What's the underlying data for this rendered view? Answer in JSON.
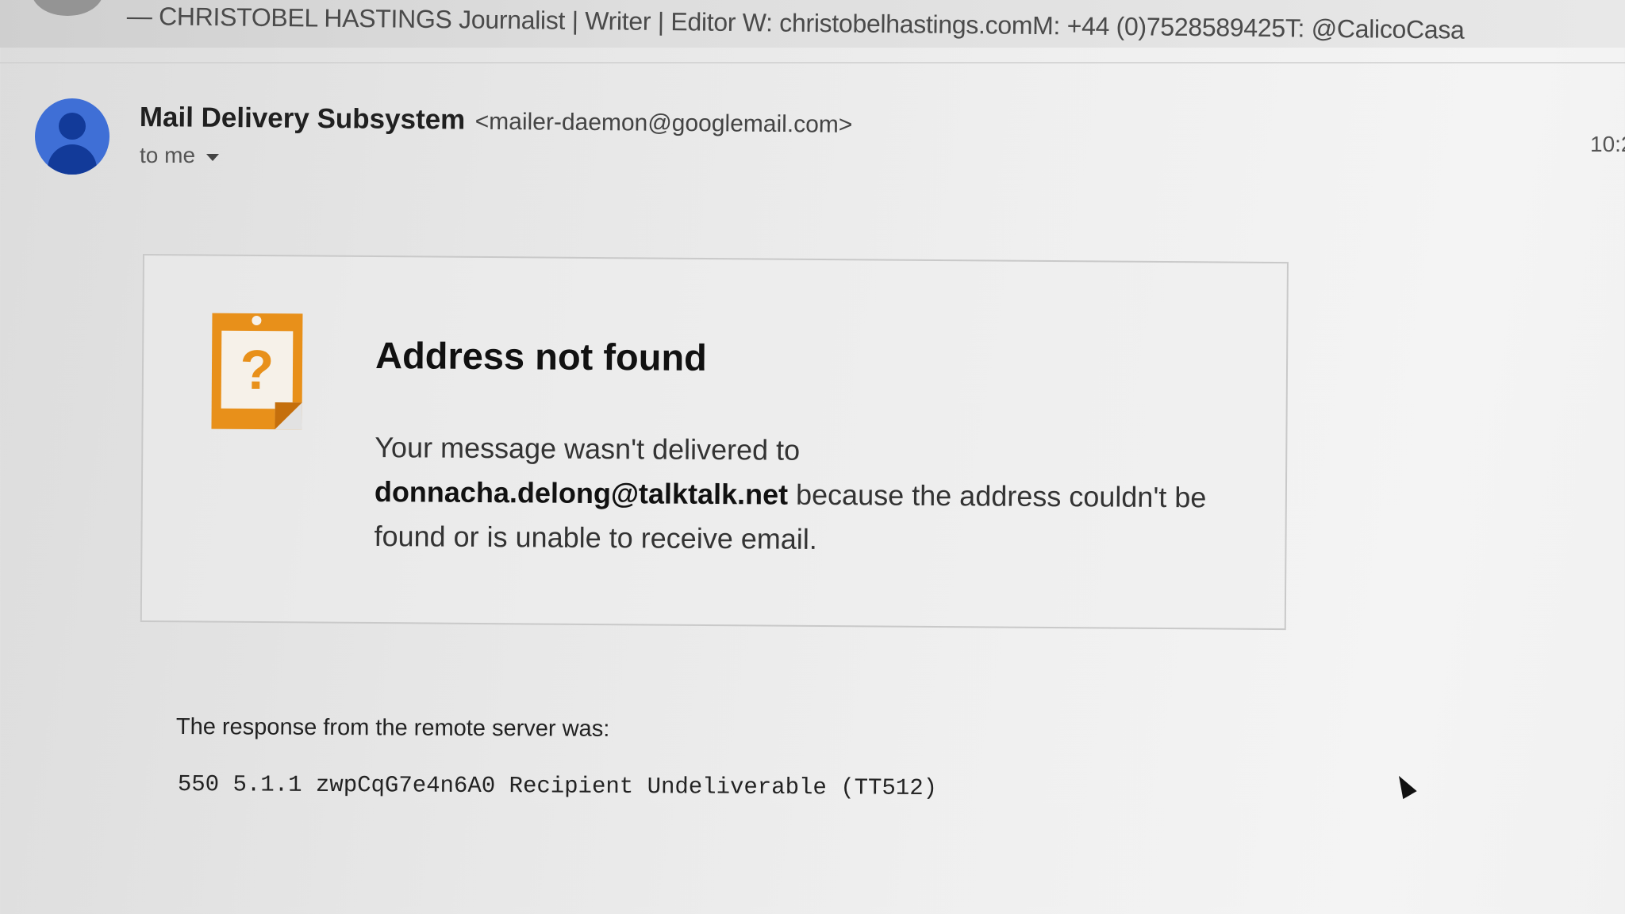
{
  "previous_message": {
    "signature": "— CHRISTOBEL HASTINGS Journalist | Writer | Editor W: christobelhastings.comM: +44 (0)7528589425T: @CalicoCasa"
  },
  "message": {
    "sender_name": "Mail Delivery Subsystem",
    "sender_email": "<mailer-daemon@googlemail.com>",
    "recipient_label": "to me",
    "time": "10:2"
  },
  "notice": {
    "icon": "question-mark-note-icon",
    "title": "Address not found",
    "body_prefix": "Your message wasn't delivered to",
    "email": "donnacha.delong@talktalk.net",
    "body_suffix": "because the address couldn't be found or is unable to receive email."
  },
  "response": {
    "label": "The response from the remote server was:",
    "code": "550 5.1.1 zwpCqG7e4n6A0 Recipient Undeliverable (TT512)"
  },
  "colors": {
    "avatar": "#3f6fd6",
    "warning_icon": "#e8901a"
  }
}
